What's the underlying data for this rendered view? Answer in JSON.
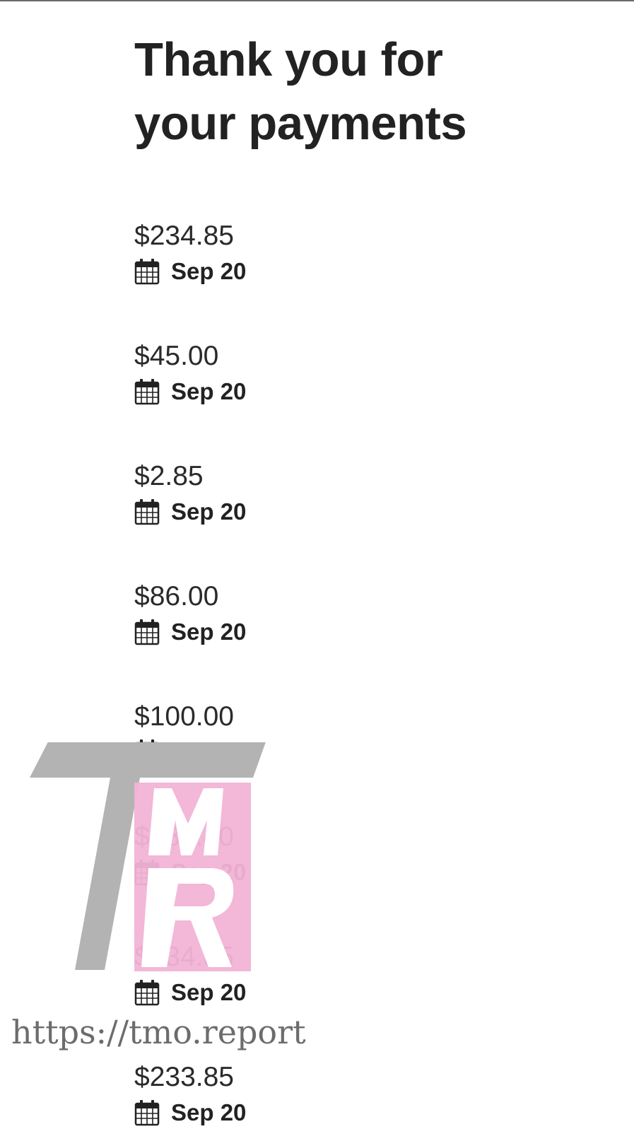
{
  "page": {
    "heading_line1": "Thank you for",
    "heading_line2": "your payments"
  },
  "payments": [
    {
      "amount": "$234.85",
      "date": "Sep 20",
      "icon": "calendar-icon"
    },
    {
      "amount": "$45.00",
      "date": "Sep 20",
      "icon": "calendar-icon"
    },
    {
      "amount": "$2.85",
      "date": "Sep 20",
      "icon": "calendar-icon"
    },
    {
      "amount": "$86.00",
      "date": "Sep 20",
      "icon": "calendar-icon"
    },
    {
      "amount": "$100.00",
      "date": "Sep 20",
      "icon": "calendar-icon"
    },
    {
      "amount": "$388.40",
      "date": "Sep 20",
      "icon": "calendar-icon"
    },
    {
      "amount": "$234.85",
      "date": "Sep 20",
      "icon": "calendar-icon"
    },
    {
      "amount": "$233.85",
      "date": "Sep 20",
      "icon": "calendar-icon"
    }
  ],
  "watermark": {
    "logo_text": "TMR",
    "url": "https://tmo.report",
    "colors": {
      "gray": "#b3b3b3",
      "pink": "#f2b3d6"
    }
  },
  "colors": {
    "text": "#222222",
    "background": "#ffffff"
  }
}
